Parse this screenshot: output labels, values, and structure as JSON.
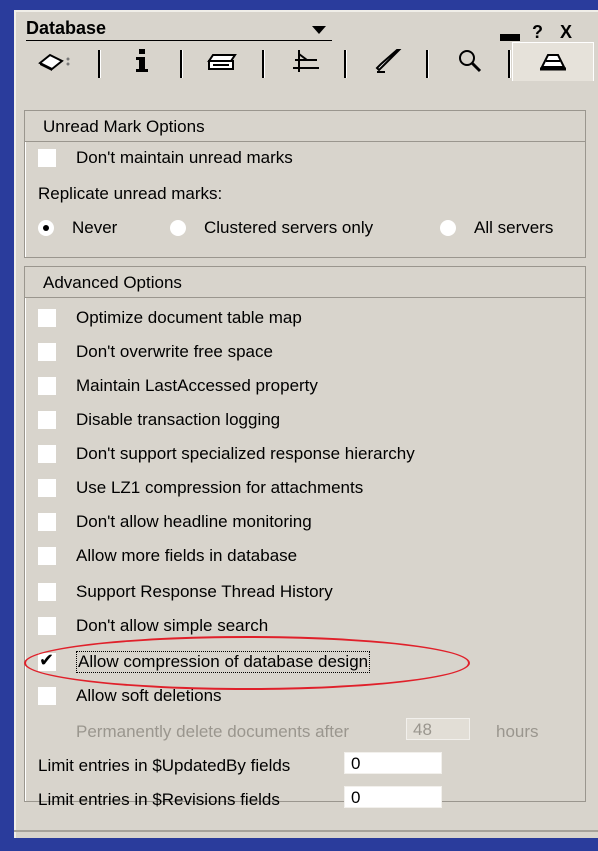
{
  "window": {
    "title": "Database",
    "controls": {
      "minimize": "▭",
      "help": "?",
      "close": "X"
    }
  },
  "tabs": [
    {
      "name": "tab-basics",
      "icon": "book-icon"
    },
    {
      "name": "tab-info",
      "icon": "info-icon"
    },
    {
      "name": "tab-print",
      "icon": "printer-icon"
    },
    {
      "name": "tab-design",
      "icon": "ruler-icon"
    },
    {
      "name": "tab-launch",
      "icon": "rocket-icon"
    },
    {
      "name": "tab-index",
      "icon": "magnifier-icon"
    },
    {
      "name": "tab-advanced",
      "icon": "hat-icon",
      "active": true
    }
  ],
  "unread": {
    "title": "Unread Mark Options",
    "dont_maintain": "Don't maintain unread marks",
    "replicate_label": "Replicate unread marks:",
    "radio_never": "Never",
    "radio_clustered": "Clustered servers only",
    "radio_all": "All servers",
    "selected": "Never"
  },
  "advanced": {
    "title": "Advanced Options",
    "options": [
      {
        "label": "Optimize document table map",
        "checked": false
      },
      {
        "label": "Don't overwrite free space",
        "checked": false
      },
      {
        "label": "Maintain LastAccessed property",
        "checked": false
      },
      {
        "label": "Disable transaction logging",
        "checked": false
      },
      {
        "label": "Don't support specialized response hierarchy",
        "checked": false
      },
      {
        "label": "Use LZ1 compression for attachments",
        "checked": false
      },
      {
        "label": "Don't allow headline monitoring",
        "checked": false
      },
      {
        "label": "Allow more fields in database",
        "checked": false
      },
      {
        "label": "Support Response Thread History",
        "checked": false
      },
      {
        "label": "Don't allow simple search",
        "checked": false
      },
      {
        "label": "Allow compression of database design",
        "checked": true
      },
      {
        "label": "Allow soft deletions",
        "checked": false
      }
    ],
    "perm_delete_prefix": "Permanently delete documents after",
    "perm_delete_value": "48",
    "perm_delete_suffix": "hours",
    "updated_by_label": "Limit entries in $UpdatedBy fields",
    "updated_by_value": "0",
    "revisions_label": "Limit entries in $Revisions fields",
    "revisions_value": "0"
  }
}
